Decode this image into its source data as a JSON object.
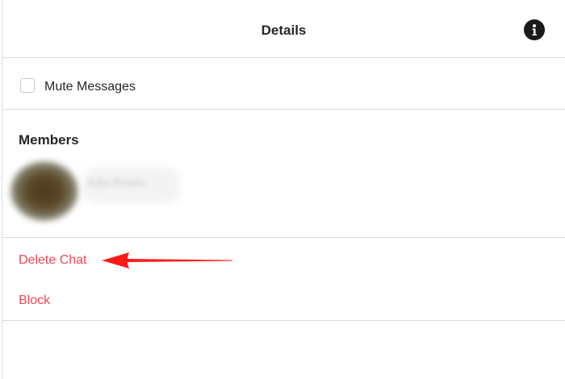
{
  "header": {
    "title": "Details",
    "info_icon": "info-circle-icon"
  },
  "settings": {
    "mute_label": "Mute Messages",
    "mute_checked": false
  },
  "members": {
    "heading": "Members",
    "list": [
      {
        "name": "Julia Brown",
        "blurred": true
      }
    ]
  },
  "actions": {
    "delete_label": "Delete Chat",
    "block_label": "Block"
  },
  "colors": {
    "danger": "#ed4956",
    "annotation": "#ff1a1a",
    "divider": "#dbdbdb"
  }
}
